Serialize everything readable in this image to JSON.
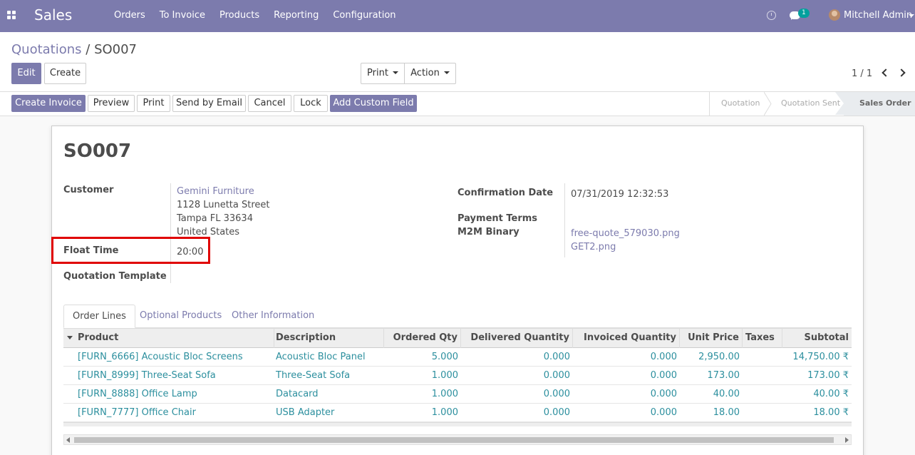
{
  "navbar": {
    "app_name": "Sales",
    "menu": [
      "Orders",
      "To Invoice",
      "Products",
      "Reporting",
      "Configuration"
    ],
    "chat_badge": "1",
    "user_name": "Mitchell Admin"
  },
  "control": {
    "breadcrumb_parent": "Quotations",
    "breadcrumb_sep": " / ",
    "breadcrumb_current": "SO007",
    "edit_label": "Edit",
    "create_label": "Create",
    "print_label": "Print",
    "action_label": "Action",
    "pager": "1 / 1"
  },
  "statusbar": {
    "buttons": [
      "Create Invoice",
      "Preview",
      "Print",
      "Send by Email",
      "Cancel",
      "Lock",
      "Add Custom Field"
    ],
    "stages": [
      "Quotation",
      "Quotation Sent",
      "Sales Order"
    ],
    "active_stage": "Sales Order"
  },
  "form": {
    "title": "SO007",
    "customer_label": "Customer",
    "customer_name": "Gemini Furniture",
    "address": [
      "1128 Lunetta Street",
      "Tampa FL 33634",
      "United States"
    ],
    "float_time_label": "Float Time",
    "float_time_value": "20:00",
    "quotation_template_label": "Quotation Template",
    "confirmation_date_label": "Confirmation Date",
    "confirmation_date_value": "07/31/2019 12:32:53",
    "payment_terms_label": "Payment Terms",
    "m2m_binary_label": "M2M Binary",
    "m2m_files": [
      "free-quote_579030.png",
      "GET2.png"
    ]
  },
  "tabs": [
    "Order Lines",
    "Optional Products",
    "Other Information"
  ],
  "table": {
    "headers": [
      "Product",
      "Description",
      "Ordered Qty",
      "Delivered Quantity",
      "Invoiced Quantity",
      "Unit Price",
      "Taxes",
      "Subtotal"
    ],
    "rows": [
      {
        "product": "[FURN_6666] Acoustic Bloc Screens",
        "description": "Acoustic Bloc Panel",
        "ordered": "5.000",
        "delivered": "0.000",
        "invoiced": "0.000",
        "unit_price": "2,950.00",
        "taxes": "",
        "subtotal": "14,750.00 ₹"
      },
      {
        "product": "[FURN_8999] Three-Seat Sofa",
        "description": "Three-Seat Sofa",
        "ordered": "1.000",
        "delivered": "0.000",
        "invoiced": "0.000",
        "unit_price": "173.00",
        "taxes": "",
        "subtotal": "173.00 ₹"
      },
      {
        "product": "[FURN_8888] Office Lamp",
        "description": "Datacard",
        "ordered": "1.000",
        "delivered": "0.000",
        "invoiced": "0.000",
        "unit_price": "40.00",
        "taxes": "",
        "subtotal": "40.00 ₹"
      },
      {
        "product": "[FURN_7777] Office Chair",
        "description": "USB Adapter",
        "ordered": "1.000",
        "delivered": "0.000",
        "invoiced": "0.000",
        "unit_price": "18.00",
        "taxes": "",
        "subtotal": "18.00 ₹"
      }
    ]
  },
  "colors": {
    "brand": "#7c7bad",
    "link": "#2c8f9e",
    "highlight": "#e00000"
  }
}
